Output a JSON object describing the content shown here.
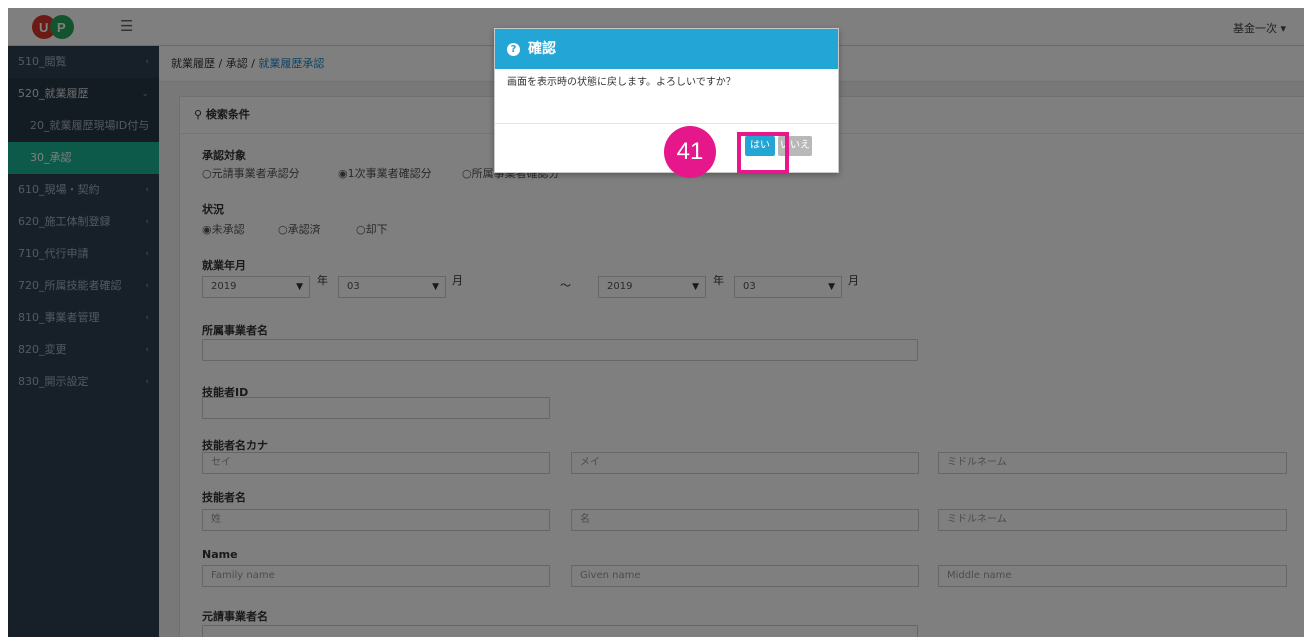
{
  "header": {
    "user_menu": "基金一次 ▾"
  },
  "sidebar": {
    "items": [
      {
        "label": "510_閲覧",
        "chevron": "‹"
      },
      {
        "label": "520_就業履歴",
        "chevron": "⌄"
      },
      {
        "label": "20_就業履歴現場ID付与",
        "chevron": ""
      },
      {
        "label": "30_承認",
        "chevron": ""
      },
      {
        "label": "610_現場・契約",
        "chevron": "‹"
      },
      {
        "label": "620_施工体制登録",
        "chevron": "‹"
      },
      {
        "label": "710_代行申請",
        "chevron": "‹"
      },
      {
        "label": "720_所属技能者確認",
        "chevron": "‹"
      },
      {
        "label": "810_事業者管理",
        "chevron": "‹"
      },
      {
        "label": "820_変更",
        "chevron": "‹"
      },
      {
        "label": "830_開示設定",
        "chevron": "‹"
      }
    ]
  },
  "breadcrumb": {
    "item1": "就業履歴",
    "sep": " / ",
    "item2": "承認",
    "current": "就業履歴承認"
  },
  "search": {
    "title": "検索条件",
    "target_label": "承認対象",
    "target_options": [
      "○元請事業者承認分",
      "◉1次事業者確認分",
      "○所属事業者確認分"
    ],
    "status_label": "状況",
    "status_options": [
      "◉未承認",
      "○承認済",
      "○却下"
    ],
    "period_label": "就業年月",
    "from_year": "2019",
    "from_month": "03",
    "to_year": "2019",
    "to_month": "03",
    "year_unit": "年",
    "month_unit": "月",
    "tilde": "～",
    "company_label": "所属事業者名",
    "worker_id_label": "技能者ID",
    "kana_label": "技能者名カナ",
    "kana_placeholders": [
      "セイ",
      "メイ",
      "ミドルネーム"
    ],
    "name_label": "技能者名",
    "name_placeholders": [
      "姓",
      "名",
      "ミドルネーム"
    ],
    "roman_label": "Name",
    "roman_placeholders": [
      "Family name",
      "Given name",
      "Middle name"
    ],
    "prime_label": "元請事業者名"
  },
  "dialog": {
    "title": "確認",
    "message": "画面を表示時の状態に戻します。よろしいですか？",
    "yes": "はい",
    "no": "いいえ"
  },
  "annotation": {
    "step": "41",
    "color": "#e5178a"
  }
}
